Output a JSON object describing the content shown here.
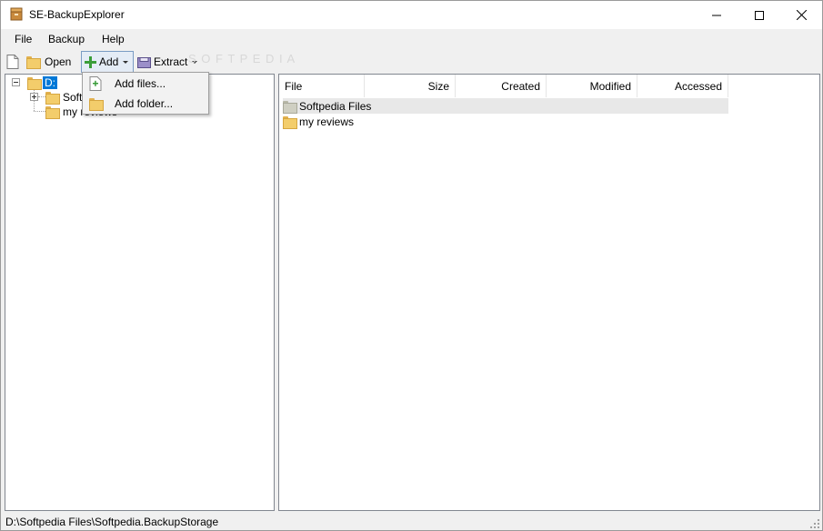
{
  "window": {
    "title": "SE-BackupExplorer"
  },
  "menu": {
    "items": [
      "File",
      "Backup",
      "Help"
    ]
  },
  "toolbar": {
    "open_label": "Open",
    "add_label": "Add",
    "extract_label": "Extract",
    "watermark": "S O F T P E D I A"
  },
  "add_menu": {
    "items": [
      "Add files...",
      "Add folder..."
    ]
  },
  "tree": {
    "root_label": "D:",
    "children": [
      "Softpedia Files",
      "my reviews"
    ]
  },
  "listview": {
    "columns": [
      "File",
      "Size",
      "Created",
      "Modified",
      "Accessed"
    ],
    "rows": [
      {
        "name": "Softpedia Files"
      },
      {
        "name": "my reviews"
      }
    ]
  },
  "status": {
    "path": "D:\\Softpedia Files\\Softpedia.BackupStorage"
  }
}
